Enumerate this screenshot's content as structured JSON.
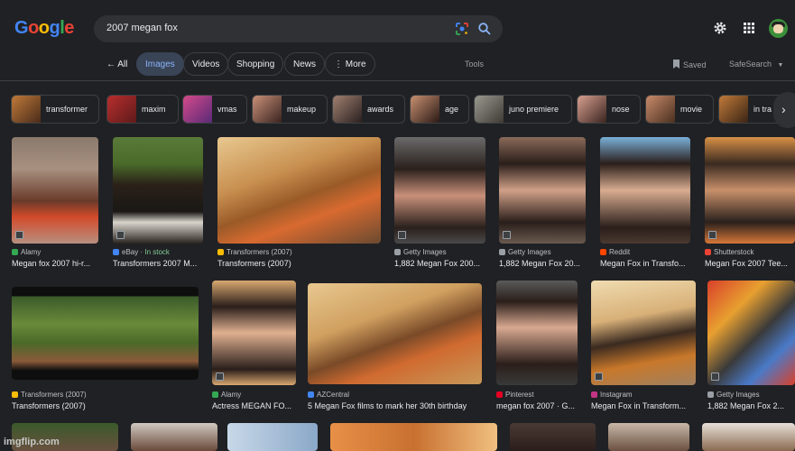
{
  "logo": {
    "g1": "G",
    "o1": "o",
    "o2": "o",
    "g2": "g",
    "l": "l",
    "e": "e"
  },
  "search": {
    "query": "2007 megan fox"
  },
  "tabs": [
    {
      "label": "All"
    },
    {
      "label": "Images"
    },
    {
      "label": "Videos"
    },
    {
      "label": "Shopping"
    },
    {
      "label": "News"
    },
    {
      "label": "More"
    }
  ],
  "toolbar": {
    "tools": "Tools",
    "saved": "Saved",
    "safesearch": "SafeSearch"
  },
  "chips": [
    "transformer",
    "maxim",
    "vmas",
    "makeup",
    "awards",
    "age",
    "juno premiere",
    "nose",
    "movie",
    "in tra"
  ],
  "results": [
    {
      "source": "Alamy",
      "title": "Megan fox 2007 hi-r..."
    },
    {
      "source": "eBay",
      "stock": "In stock",
      "title": "Transformers 2007 M..."
    },
    {
      "source": "Transformers (2007)",
      "title": "Transformers (2007)"
    },
    {
      "source": "Getty Images",
      "title": "1,882 Megan Fox 200..."
    },
    {
      "source": "Getty Images",
      "title": "1,882 Megan Fox 20..."
    },
    {
      "source": "Reddit",
      "title": "Megan Fox in Transfo..."
    },
    {
      "source": "Shutterstock",
      "title": "Megan Fox 2007 Tee..."
    },
    {
      "source": "Transformers (2007)",
      "title": "Transformers (2007)"
    },
    {
      "source": "Alamy",
      "title": "Actress MEGAN FO..."
    },
    {
      "source": "AZCentral",
      "title": "5 Megan Fox films to mark her 30th birthday"
    },
    {
      "source": "Pinterest",
      "title": "megan fox 2007 · G..."
    },
    {
      "source": "Instagram",
      "title": "Megan Fox in Transform..."
    },
    {
      "source": "Getty Images",
      "title": "1,882 Megan Fox 2..."
    }
  ],
  "watermark": "imgflip.com",
  "colors": {
    "background": "#202124",
    "active_tab": "#394457",
    "accent": "#8ab4f8"
  }
}
